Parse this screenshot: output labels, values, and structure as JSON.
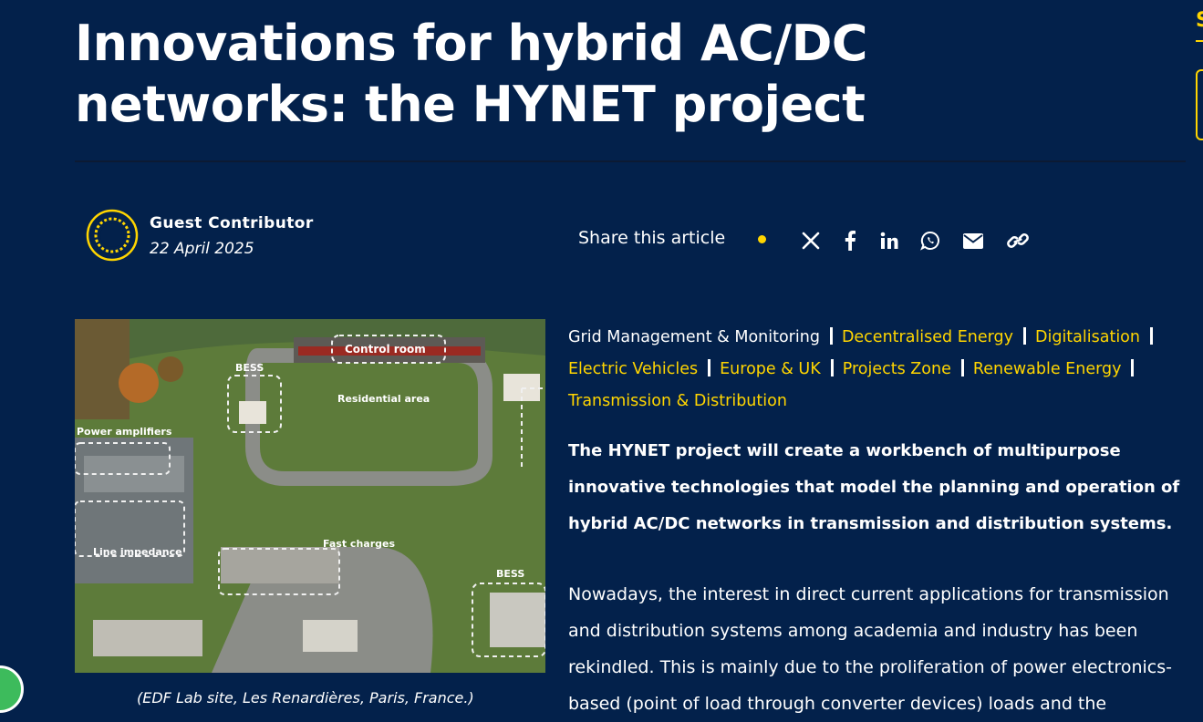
{
  "article": {
    "title": "Innovations for hybrid AC/DC networks: the HYNET project",
    "author": "Guest Contributor",
    "date": "22 April 2025",
    "caption": "(EDF Lab site, Les Renardières, Paris, France.)"
  },
  "share": {
    "label": "Share this article",
    "icons": [
      "x-icon",
      "facebook-icon",
      "linkedin-icon",
      "whatsapp-icon",
      "email-icon",
      "link-icon"
    ]
  },
  "photo": {
    "labels": {
      "control_room": "Control room",
      "bess_1": "BESS",
      "residential": "Residential area",
      "power_amplifiers": "Power amplifiers",
      "line_impedance": "Line impedance",
      "fast_charges": "Fast charges",
      "bess_2": "BESS"
    }
  },
  "tags": [
    "Grid Management & Monitoring",
    "Decentralised Energy",
    "Digitalisation",
    "Electric Vehicles",
    "Europe & UK",
    "Projects Zone",
    "Renewable Energy",
    "Transmission & Distribution"
  ],
  "lead": "The HYNET project will create a workbench of multipurpose innovative technologies that model the planning and operation of hybrid AC/DC networks in transmission and distribution systems.",
  "body": "Nowadays, the interest in direct current applications for transmission and distribution systems among academia and industry has been rekindled. This is mainly due to the proliferation of power electronics-based (point of load through converter devices) loads and the",
  "sidebar": {
    "letter": "S"
  },
  "colors": {
    "background": "#03214b",
    "accent": "#ffd500",
    "text": "#ffffff"
  }
}
